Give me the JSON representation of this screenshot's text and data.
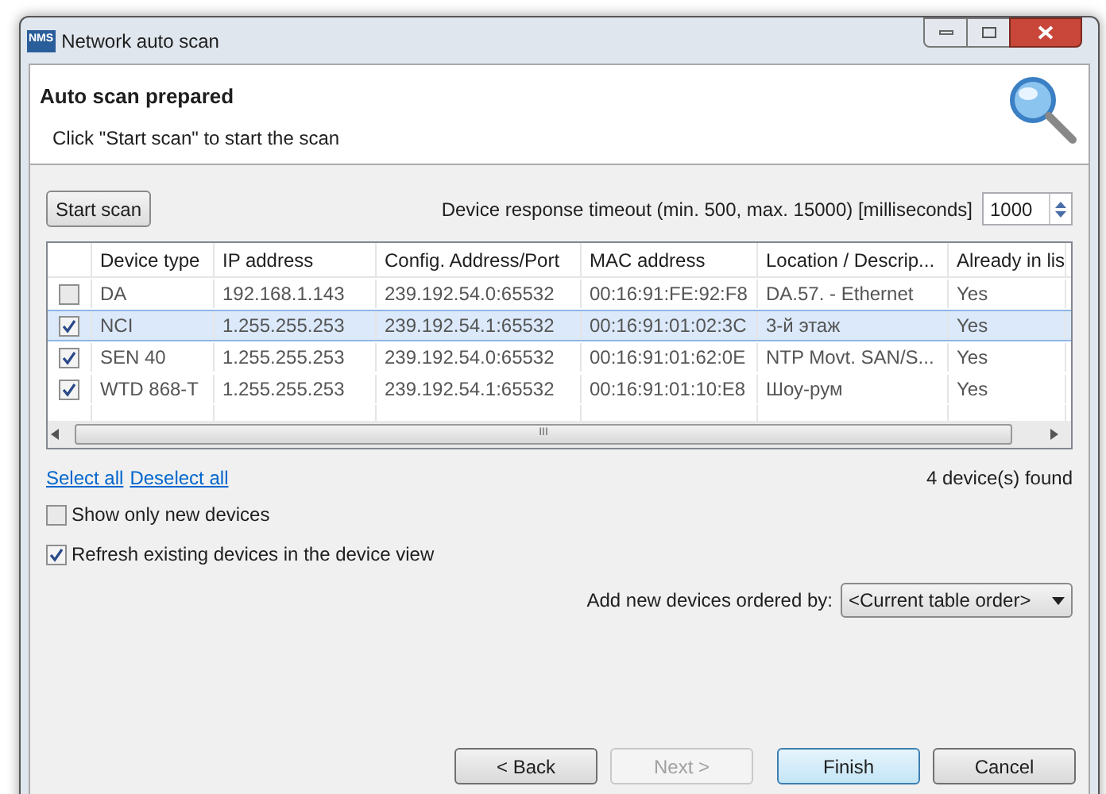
{
  "window": {
    "app_icon": "NMS",
    "title": "Network auto scan"
  },
  "header": {
    "title": "Auto scan prepared",
    "subtitle": "Click \"Start scan\" to start the scan"
  },
  "start_button": "Start scan",
  "timeout": {
    "label": "Device response timeout (min. 500, max. 15000) [milliseconds]",
    "value": "1000"
  },
  "table": {
    "columns": [
      "Device type",
      "IP address",
      "Config. Address/Port",
      "MAC address",
      "Location / Descrip...",
      "Already in lis"
    ],
    "rows": [
      {
        "checked": false,
        "selected": false,
        "cells": [
          "DA",
          "192.168.1.143",
          "239.192.54.0:65532",
          "00:16:91:FE:92:F8",
          "DA.57. - Ethernet",
          "Yes"
        ]
      },
      {
        "checked": true,
        "selected": true,
        "cells": [
          "NCI",
          "1.255.255.253",
          "239.192.54.1:65532",
          "00:16:91:01:02:3C",
          "3-й этаж",
          "Yes"
        ]
      },
      {
        "checked": true,
        "selected": false,
        "cells": [
          "SEN 40",
          "1.255.255.253",
          "239.192.54.0:65532",
          "00:16:91:01:62:0E",
          "NTP Movt. SAN/S...",
          "Yes"
        ]
      },
      {
        "checked": true,
        "selected": false,
        "cells": [
          "WTD 868-T",
          "1.255.255.253",
          "239.192.54.1:65532",
          "00:16:91:01:10:E8",
          "Шоу-рум",
          "Yes"
        ]
      }
    ],
    "scrollbar_grip": "III"
  },
  "links": [
    "Select all",
    "Deselect all"
  ],
  "found": "4 device(s) found",
  "options": [
    {
      "label": "Show only new devices",
      "checked": false
    },
    {
      "label": "Refresh existing devices in the device view",
      "checked": true
    }
  ],
  "order": {
    "label": "Add new devices ordered by:",
    "value": "<Current table order>"
  },
  "buttons": [
    {
      "label": "< Back",
      "disabled": false,
      "default": false
    },
    {
      "label": "Next >",
      "disabled": true,
      "default": false
    },
    {
      "label": "Finish",
      "disabled": false,
      "default": true
    },
    {
      "label": "Cancel",
      "disabled": false,
      "default": false
    }
  ]
}
